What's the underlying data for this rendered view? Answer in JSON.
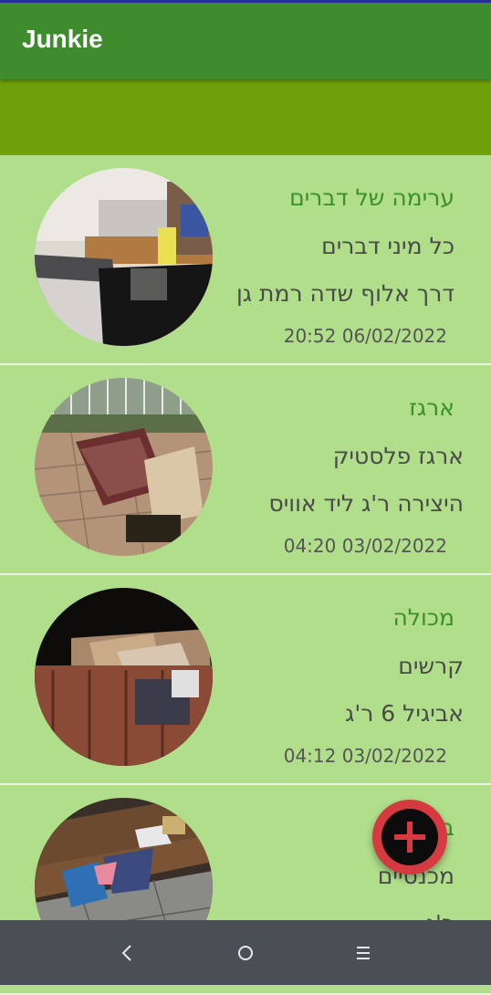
{
  "app": {
    "title": "Junkie"
  },
  "colors": {
    "appbar": "#3e8c2e",
    "toolbar": "#6ea108",
    "list_bg": "#b0de8a",
    "title_text": "#3c8f2a",
    "fab": "#d43a3f"
  },
  "toolbar": {
    "list_icon": "list-icon",
    "logout_icon": "logout-icon"
  },
  "items": [
    {
      "title": "ערימה של דברים",
      "subtitle": "כל מיני דברים",
      "location": "דרך אלוף שדה רמת גן",
      "date": "06/02/2022 20:52"
    },
    {
      "title": "ארגז",
      "subtitle": "ארגז פלסטיק",
      "location": "היצירה ר'ג ליד אוויס",
      "date": "03/02/2022 04:20"
    },
    {
      "title": "מכולה",
      "subtitle": "קרשים",
      "location": "אביגיל 6 ר'ג",
      "date": "03/02/2022 04:12"
    },
    {
      "title": "בגדים",
      "subtitle": "מכנסיים",
      "location": "ר'ג",
      "date": ""
    }
  ],
  "fab": {
    "icon": "plus-icon"
  },
  "navbar": {
    "back_icon": "back-icon",
    "home_icon": "home-icon",
    "recents_icon": "recents-icon"
  }
}
